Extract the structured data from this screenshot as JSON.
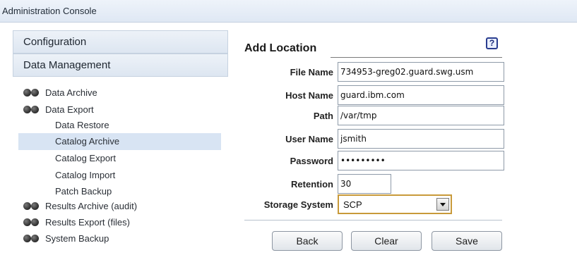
{
  "app": {
    "title": "Administration Console"
  },
  "sidebar": {
    "sections": [
      "Configuration",
      "Data Management"
    ],
    "items": [
      {
        "label": "Data Archive",
        "bullet": true,
        "selected": false
      },
      {
        "label": "Data Export",
        "bullet": true,
        "selected": false
      },
      {
        "label": "Data Restore",
        "bullet": false,
        "selected": false
      },
      {
        "label": "Catalog Archive",
        "bullet": false,
        "selected": true
      },
      {
        "label": "Catalog Export",
        "bullet": false,
        "selected": false
      },
      {
        "label": "Catalog Import",
        "bullet": false,
        "selected": false
      },
      {
        "label": "Patch Backup",
        "bullet": false,
        "selected": false
      },
      {
        "label": "Results Archive (audit)",
        "bullet": true,
        "selected": false
      },
      {
        "label": "Results Export (files)",
        "bullet": true,
        "selected": false
      },
      {
        "label": "System Backup",
        "bullet": true,
        "selected": false
      }
    ]
  },
  "form": {
    "title": "Add Location",
    "help_icon": "?",
    "fields": [
      {
        "label": "File Name",
        "value": "734953-greg02.guard.swg.usm"
      },
      {
        "label": "Host Name",
        "value": "guard.ibm.com"
      },
      {
        "label": "Path",
        "value": "/var/tmp"
      },
      {
        "label": "User Name",
        "value": "jsmith"
      },
      {
        "label": "Password",
        "value": "•••••••••"
      },
      {
        "label": "Retention",
        "value": "30"
      }
    ],
    "storage": {
      "label": "Storage System",
      "value": "SCP"
    },
    "buttons": {
      "back": "Back",
      "clear": "Clear",
      "save": "Save"
    }
  },
  "colors": {
    "selected_bg": "#d8e4f3",
    "select_border": "#c89a3a",
    "help_border": "#2a3d8f"
  }
}
